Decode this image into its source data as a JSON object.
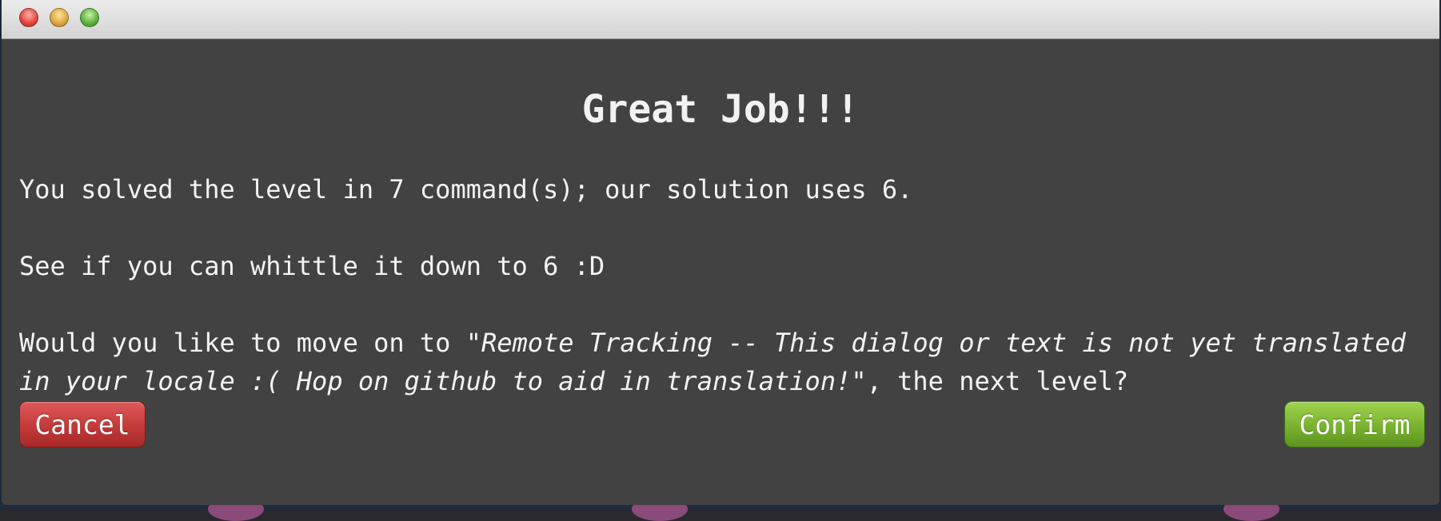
{
  "window": {
    "controls": [
      "close-icon",
      "minimize-icon",
      "zoom-icon"
    ]
  },
  "dialog": {
    "heading": "Great Job!!!",
    "line1": "You solved the level in 7 command(s); our solution uses 6.",
    "line2": "See if you can whittle it down to 6 :D",
    "line3_prefix": "Would you like to move on to \"",
    "line3_level_name": "Remote Tracking -- This dialog or text is not yet translated in your locale :( Hop on github to aid in translation!",
    "line3_suffix": "\", the next level?"
  },
  "buttons": {
    "cancel_label": "Cancel",
    "confirm_label": "Confirm"
  },
  "colors": {
    "dialog_background": "#424242",
    "cancel": "#c23a39",
    "confirm": "#79b22f"
  }
}
